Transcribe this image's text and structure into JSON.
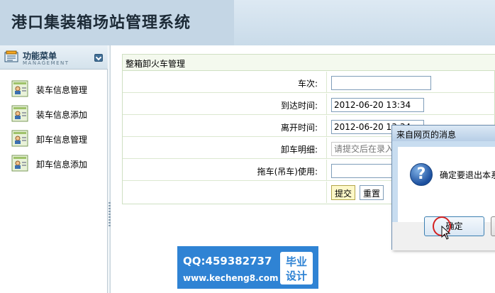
{
  "header": {
    "title": "港口集装箱场站管理系统"
  },
  "sidebar": {
    "title": "功能菜单",
    "subtitle": "MANAGEMENT",
    "items": [
      {
        "label": "装车信息管理"
      },
      {
        "label": "装车信息添加"
      },
      {
        "label": "卸车信息管理"
      },
      {
        "label": "卸车信息添加"
      }
    ]
  },
  "form": {
    "title": "整箱卸火车管理",
    "fields": [
      {
        "label": "车次:",
        "value": ""
      },
      {
        "label": "到达时间:",
        "value": "2012-06-20 13:34"
      },
      {
        "label": "离开时间:",
        "value": "2012-06-20 13:34"
      },
      {
        "label": "卸车明细:",
        "placeholder": "请提交后在录入"
      },
      {
        "label": "拖车(吊车)使用:",
        "value": ""
      }
    ],
    "submit_label": "提交",
    "reset_label": "重置"
  },
  "dialog": {
    "title": "来自网页的消息",
    "message": "确定要退出本系",
    "ok_label": "确定"
  },
  "watermark": {
    "qq": "QQ:459382737",
    "url": "www.kecheng8.com",
    "badge_line1": "毕业",
    "badge_line2": "设计"
  },
  "colors": {
    "header_bg": "#c9dbe9",
    "form_border": "#cfe0c3",
    "watermark_bg": "#2f83d4",
    "dialog_frame": "#c8ddf0"
  }
}
